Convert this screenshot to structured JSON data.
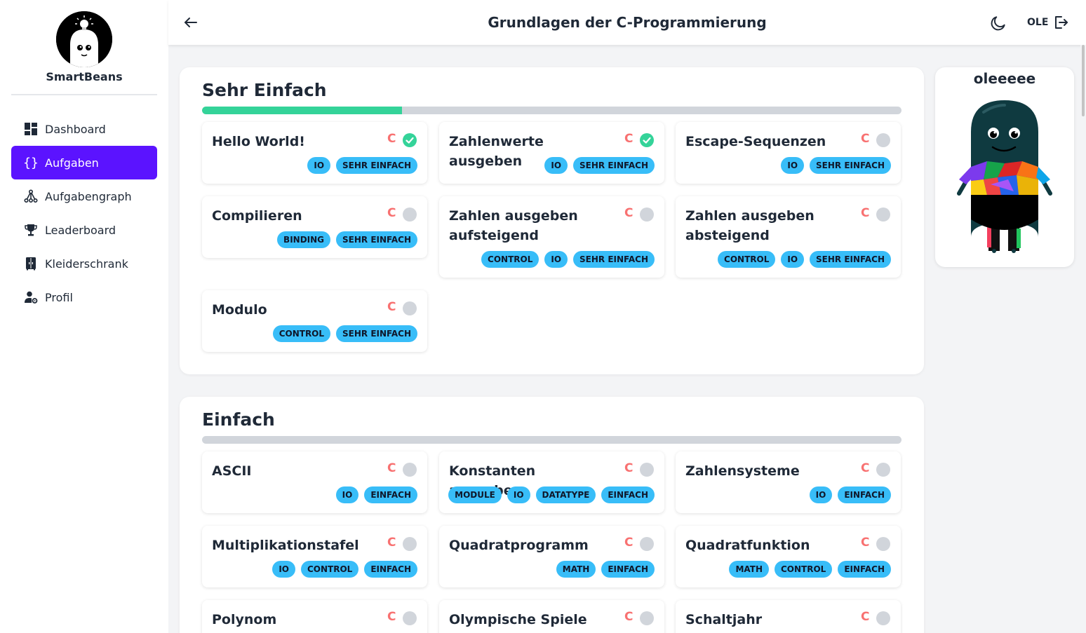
{
  "app": {
    "name": "SmartBeans"
  },
  "sidebar": {
    "items": [
      {
        "label": "Dashboard",
        "icon": "dashboard-icon",
        "active": false
      },
      {
        "label": "Aufgaben",
        "icon": "code-braces-icon",
        "active": true
      },
      {
        "label": "Aufgabengraph",
        "icon": "graph-icon",
        "active": false
      },
      {
        "label": "Leaderboard",
        "icon": "trophy-icon",
        "active": false
      },
      {
        "label": "Kleiderschrank",
        "icon": "wardrobe-icon",
        "active": false
      },
      {
        "label": "Profil",
        "icon": "user-settings-icon",
        "active": false
      }
    ]
  },
  "header": {
    "title": "Grundlagen der C-Programmierung",
    "user": "OLE"
  },
  "colors": {
    "accent": "#5b13ff",
    "progress": "#34d399",
    "tag": "#38bdf8",
    "lang": "#f87171",
    "done": "#34d399",
    "open": "#d1d5db"
  },
  "sections": [
    {
      "title": "Sehr Einfach",
      "progress": 0.286,
      "tasks": [
        {
          "title": "Hello World!",
          "lang": "C",
          "done": true,
          "tags": [
            "IO",
            "SEHR EINFACH"
          ]
        },
        {
          "title": "Zahlenwerte ausgeben",
          "lang": "C",
          "done": true,
          "tags": [
            "IO",
            "SEHR EINFACH"
          ]
        },
        {
          "title": "Escape-Sequenzen",
          "lang": "C",
          "done": false,
          "tags": [
            "IO",
            "SEHR EINFACH"
          ]
        },
        {
          "title": "Compilieren",
          "lang": "C",
          "done": false,
          "tags": [
            "BINDING",
            "SEHR EINFACH"
          ]
        },
        {
          "title": "Zahlen ausgeben aufsteigend",
          "lang": "C",
          "done": false,
          "tags": [
            "CONTROL",
            "IO",
            "SEHR EINFACH"
          ]
        },
        {
          "title": "Zahlen ausgeben absteigend",
          "lang": "C",
          "done": false,
          "tags": [
            "CONTROL",
            "IO",
            "SEHR EINFACH"
          ]
        },
        {
          "title": "Modulo",
          "lang": "C",
          "done": false,
          "tags": [
            "CONTROL",
            "SEHR EINFACH"
          ]
        }
      ]
    },
    {
      "title": "Einfach",
      "progress": 0,
      "tasks": [
        {
          "title": "ASCII",
          "lang": "C",
          "done": false,
          "tags": [
            "IO",
            "EINFACH"
          ]
        },
        {
          "title": "Konstanten ausgeben",
          "lang": "C",
          "done": false,
          "tags": [
            "MODULE",
            "IO",
            "DATATYPE",
            "EINFACH"
          ]
        },
        {
          "title": "Zahlensysteme",
          "lang": "C",
          "done": false,
          "tags": [
            "IO",
            "EINFACH"
          ]
        },
        {
          "title": "Multiplikationstafel",
          "lang": "C",
          "done": false,
          "tags": [
            "IO",
            "CONTROL",
            "EINFACH"
          ]
        },
        {
          "title": "Quadratprogramm",
          "lang": "C",
          "done": false,
          "tags": [
            "MATH",
            "EINFACH"
          ]
        },
        {
          "title": "Quadratfunktion",
          "lang": "C",
          "done": false,
          "tags": [
            "MATH",
            "CONTROL",
            "EINFACH"
          ]
        },
        {
          "title": "Polynom",
          "lang": "C",
          "done": false,
          "tags": []
        },
        {
          "title": "Olympische Spiele",
          "lang": "C",
          "done": false,
          "tags": []
        },
        {
          "title": "Schaltjahr",
          "lang": "C",
          "done": false,
          "tags": []
        }
      ]
    }
  ],
  "avatar": {
    "name": "oleeeee"
  }
}
